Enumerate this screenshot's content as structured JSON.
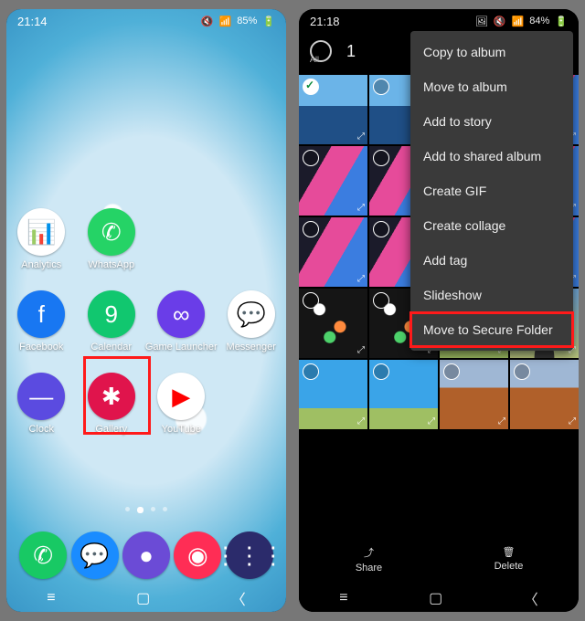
{
  "left": {
    "status": {
      "time": "21:14",
      "battery": "85%",
      "icons": "📶"
    },
    "apps": {
      "row1": [
        {
          "label": "Analytics",
          "bg": "#ffffff",
          "glyph": "📊",
          "fg": "#f5a623"
        },
        {
          "label": "WhatsApp",
          "bg": "#25D366",
          "glyph": "✆",
          "fg": "#fff"
        }
      ],
      "row2": [
        {
          "label": "Facebook",
          "bg": "#1877F2",
          "glyph": "f",
          "fg": "#fff"
        },
        {
          "label": "Calendar",
          "bg": "#11c76f",
          "glyph": "9",
          "fg": "#fff"
        },
        {
          "label": "Game Launcher",
          "bg": "#6a3de8",
          "glyph": "∞",
          "fg": "#fff"
        },
        {
          "label": "Messenger",
          "bg": "#ffffff",
          "glyph": "💬",
          "fg": "#0084FF"
        }
      ],
      "row3": [
        {
          "label": "Clock",
          "bg": "#5b4be0",
          "glyph": "—",
          "fg": "#fff"
        },
        {
          "label": "Gallery",
          "bg": "#e0144c",
          "glyph": "✱",
          "fg": "#fff"
        },
        {
          "label": "YouTube",
          "bg": "#ffffff",
          "glyph": "▶",
          "fg": "#ff0000"
        }
      ]
    },
    "dock": [
      {
        "bg": "#18c964",
        "glyph": "✆"
      },
      {
        "bg": "#1a8cff",
        "glyph": "💬"
      },
      {
        "bg": "#6b4bd6",
        "glyph": "●"
      },
      {
        "bg": "#ff2d55",
        "glyph": "◉"
      },
      {
        "bg": "#2b2b6b",
        "glyph": "⋮⋮⋮"
      }
    ],
    "highlighted_app": "Gallery"
  },
  "right": {
    "status": {
      "time": "21:18",
      "battery": "84%",
      "icons": "📶"
    },
    "selection": {
      "count": "1",
      "all_label": "All"
    },
    "menu": [
      "Copy to album",
      "Move to album",
      "Add to story",
      "Add to shared album",
      "Create GIF",
      "Create collage",
      "Add tag",
      "Slideshow",
      "Move to Secure Folder"
    ],
    "highlighted_menu_item": "Move to Secure Folder",
    "bottom": {
      "share": "Share",
      "delete": "Delete"
    },
    "thumbs": [
      {
        "kind": "p-sea",
        "checked": true
      },
      {
        "kind": "p-sea",
        "checked": false
      },
      {
        "kind": "p-ph",
        "checked": false
      },
      {
        "kind": "p-ph",
        "checked": false
      },
      {
        "kind": "p-ph",
        "checked": false
      },
      {
        "kind": "p-ph",
        "checked": false
      },
      {
        "kind": "p-ph",
        "checked": false
      },
      {
        "kind": "p-ph",
        "checked": false
      },
      {
        "kind": "p-ph",
        "checked": false
      },
      {
        "kind": "p-ph",
        "checked": false
      },
      {
        "kind": "p-ph",
        "checked": false
      },
      {
        "kind": "p-ph",
        "checked": false
      },
      {
        "kind": "p-apps",
        "checked": false
      },
      {
        "kind": "p-apps",
        "checked": false
      },
      {
        "kind": "p-sky",
        "checked": false
      },
      {
        "kind": "p-road",
        "checked": false
      },
      {
        "kind": "p-sky",
        "checked": false
      },
      {
        "kind": "p-sky",
        "checked": false
      },
      {
        "kind": "p-dirt",
        "checked": false
      },
      {
        "kind": "p-dirt",
        "checked": false
      },
      {
        "kind": "p-empty",
        "checked": false
      },
      {
        "kind": "p-empty",
        "checked": false
      },
      {
        "kind": "p-empty",
        "checked": false
      },
      {
        "kind": "p-empty",
        "checked": false
      }
    ]
  }
}
